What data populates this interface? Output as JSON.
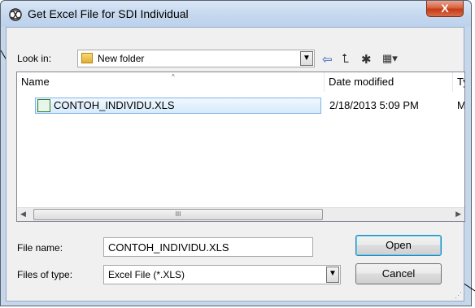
{
  "window": {
    "title": "Get Excel File for SDI Individual",
    "close_label": "X"
  },
  "toolbar": {
    "look_in_label": "Look in:",
    "folder_name": "New folder",
    "icons": [
      "back-arrow-icon",
      "up-folder-icon",
      "new-folder-icon",
      "view-menu-icon"
    ]
  },
  "file_list": {
    "columns": [
      "Name",
      "Date modified",
      "Ty"
    ],
    "rows": [
      {
        "name": "CONTOH_INDIVIDU.XLS",
        "date": "2/18/2013 5:09 PM",
        "type": "M"
      }
    ],
    "scroll_grip": "III"
  },
  "form": {
    "file_name_label": "File name:",
    "file_name_value": "CONTOH_INDIVIDU.XLS",
    "file_type_label": "Files of type:",
    "file_type_value": "Excel File (*.XLS)",
    "open_label": "Open",
    "cancel_label": "Cancel"
  }
}
